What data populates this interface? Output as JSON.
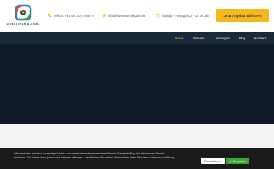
{
  "brand": {
    "logo_text": "LIVESTREAM ALLGÄU",
    "colors": {
      "navy": "#1b2a3b",
      "accent": "#f5b81c",
      "logo_red": "#e84c2a",
      "logo_blue": "#1f7fc1",
      "logo_green": "#3fa535"
    }
  },
  "header": {
    "phone": "Telefon: +49 (0) 1575 265270",
    "email": "info@livestream-allgaeu.de",
    "hours": "Montag – Freitag 8:00 – 17:00 Uhr",
    "cta_label": "Jetzt Angebot anfordern",
    "icons": [
      "phone-icon",
      "home-icon",
      "calendar-icon"
    ]
  },
  "nav": {
    "items": [
      {
        "label": "Home",
        "active": true
      },
      {
        "label": "Service"
      },
      {
        "label": "Leistungen"
      },
      {
        "label": "Blog"
      },
      {
        "label": "Kontakt"
      }
    ]
  },
  "cookie": {
    "text": "Wir verwenden technisch notwendige Cookies auf unserer Webseite sowie externe Dienste. Standardmäßig sind alle externen Dienste deaktiviert. Sie können diese jedoch nach belieben aktivieren & deaktivieren. Für weitere Informationen lesen Sie unsere Datenschutzerklärung.",
    "personalize_label": "Personalisieren",
    "accept_label": "Akzeptieren"
  }
}
